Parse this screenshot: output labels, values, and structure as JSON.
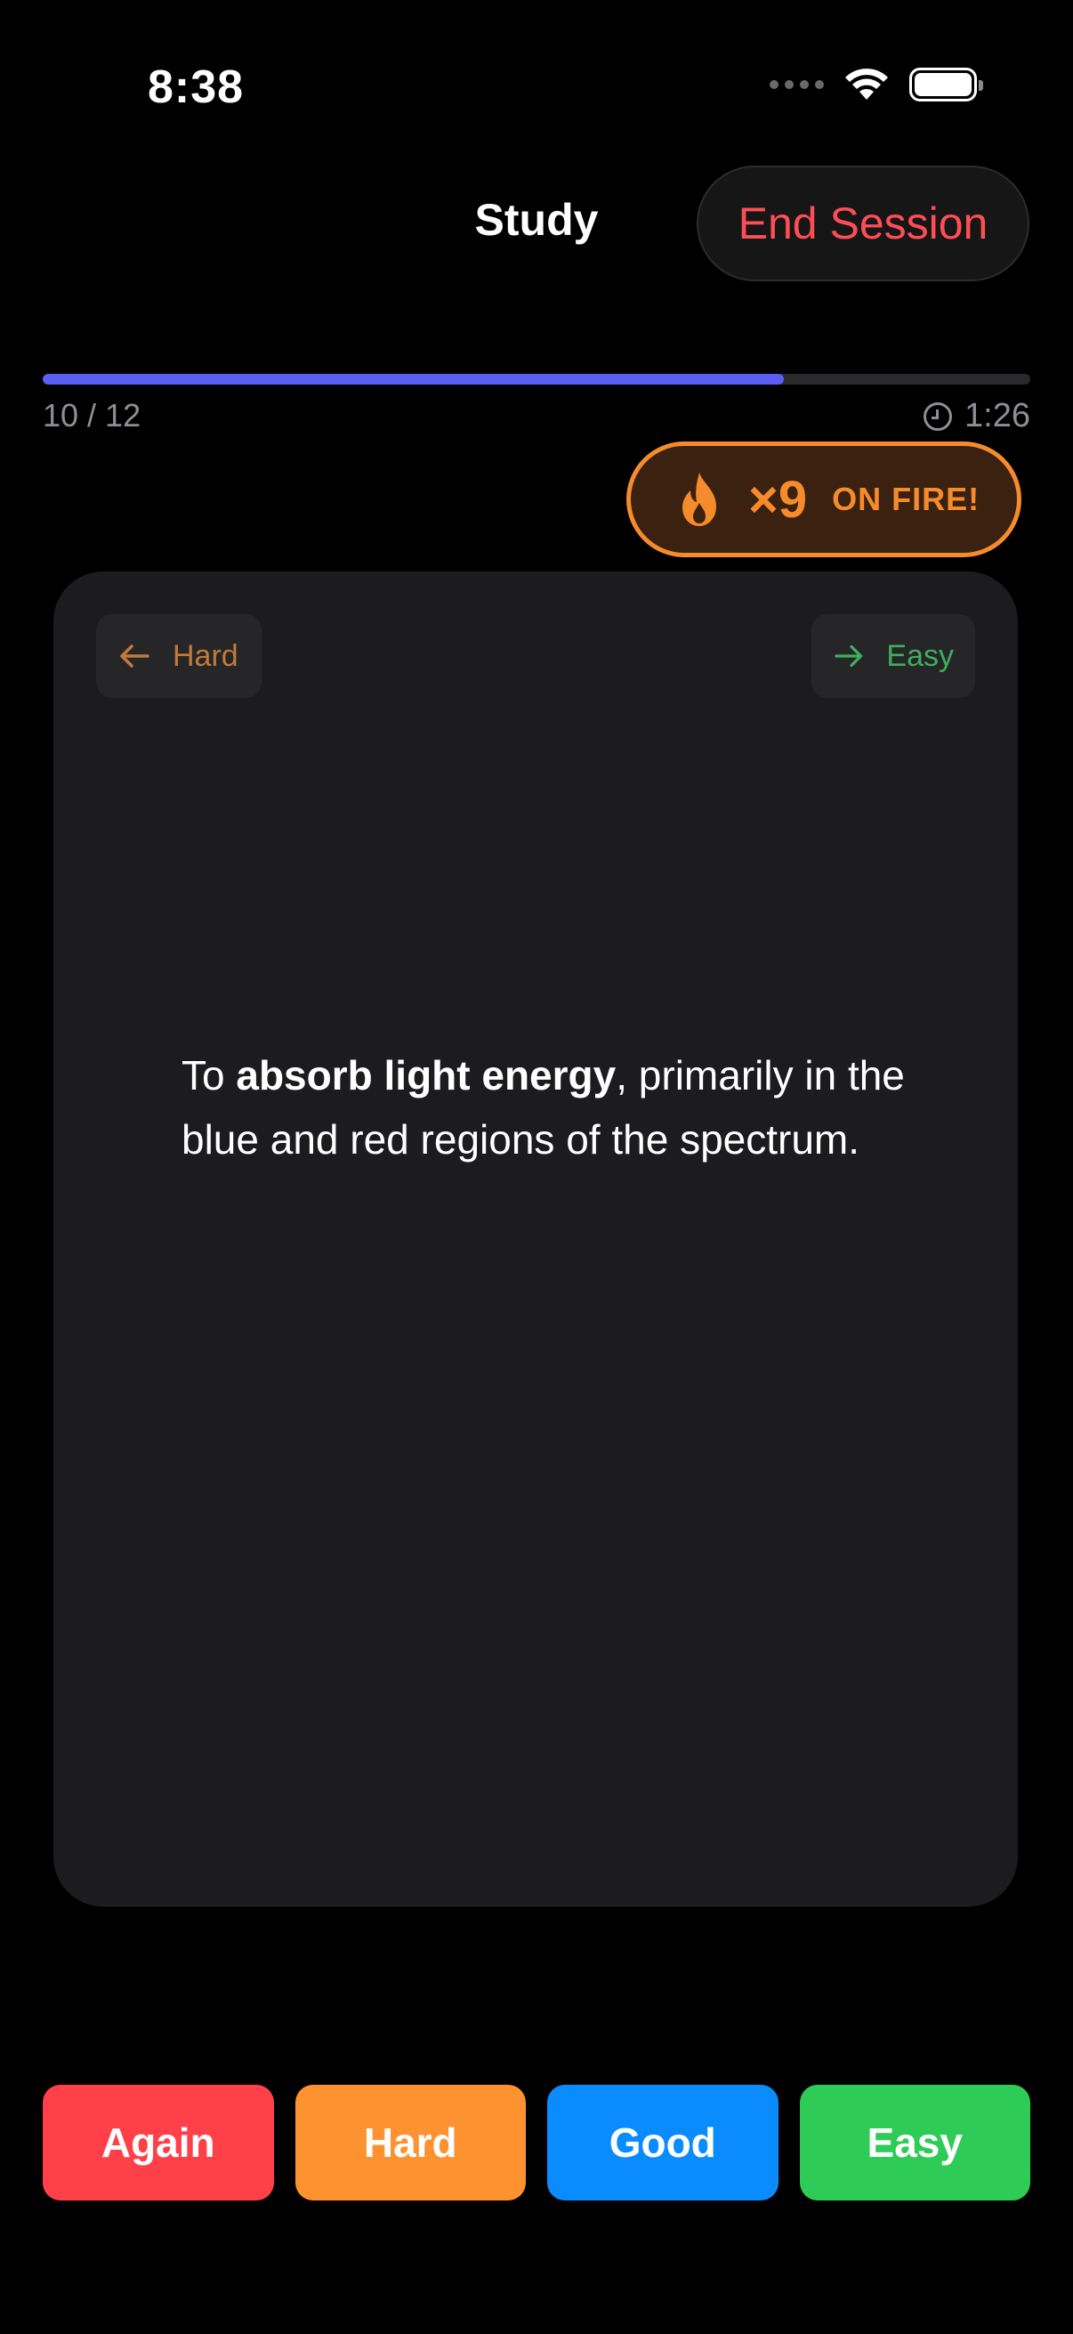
{
  "status_bar": {
    "time": "8:38"
  },
  "header": {
    "title": "Study",
    "end_session_label": "End Session"
  },
  "progress": {
    "count_label": "10 / 12",
    "fraction": 0.75,
    "timer": "1:26"
  },
  "streak": {
    "count": "×9",
    "label": "ON FIRE!"
  },
  "card": {
    "swipe_left_label": "Hard",
    "swipe_right_label": "Easy",
    "text_before": "To ",
    "text_bold": "absorb light energy",
    "text_after": ", primarily in the blue and red regions of the spectrum."
  },
  "rating_buttons": [
    {
      "label": "Again",
      "color": "#ff4049"
    },
    {
      "label": "Hard",
      "color": "#ff9230"
    },
    {
      "label": "Good",
      "color": "#0a8cff"
    },
    {
      "label": "Easy",
      "color": "#2ecb57"
    }
  ],
  "colors": {
    "progress": "#5a5ef5",
    "streak": "#f68b2c",
    "danger": "#ff4d55"
  },
  "icons": {
    "timer": "clock-icon",
    "streak": "flame-icon",
    "swipe_left": "arrow-left-icon",
    "swipe_right": "arrow-right-icon",
    "wifi": "wifi-icon",
    "battery": "battery-icon",
    "signal": "cellular-signal-icon"
  }
}
